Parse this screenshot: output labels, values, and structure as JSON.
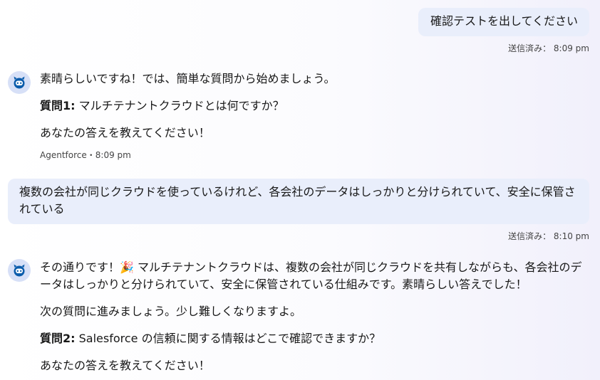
{
  "messages": {
    "user_1": {
      "text": "確認テストを出してください",
      "status": "送信済み： 8:09 pm"
    },
    "agent_1": {
      "greeting": "素晴らしいですね！では、簡単な質問から始めましょう。",
      "question_label": "質問1:",
      "question_text": " マルチテナントクラウドとは何ですか？",
      "prompt": "あなたの答えを教えてください！",
      "sender": "Agentforce",
      "separator": "・",
      "time": "8:09 pm"
    },
    "user_2": {
      "text": "複数の会社が同じクラウドを使っているけれど、各会社のデータはしっかりと分けられていて、安全に保管されている",
      "status": "送信済み： 8:10 pm"
    },
    "agent_2": {
      "lead": "その通りです！",
      "emoji": "🎉",
      "body": " マルチテナントクラウドは、複数の会社が同じクラウドを共有しながらも、各会社のデータはしっかりと分けられていて、安全に保管されている仕組みです。素晴らしい答えでした！",
      "next": "次の質問に進みましょう。少し難しくなりますよ。",
      "question_label": "質問2:",
      "question_text": " Salesforce の信頼に関する情報はどこで確認できますか？",
      "prompt": "あなたの答えを教えてください！"
    }
  },
  "icons": {
    "agent_avatar": "einstein-bot-icon",
    "celebration": "party-popper-icon"
  },
  "colors": {
    "user_bubble": "#e9eefb",
    "avatar_bg": "#d7e0f7",
    "avatar_fg": "#0b5cab",
    "meta_text": "#444444"
  }
}
